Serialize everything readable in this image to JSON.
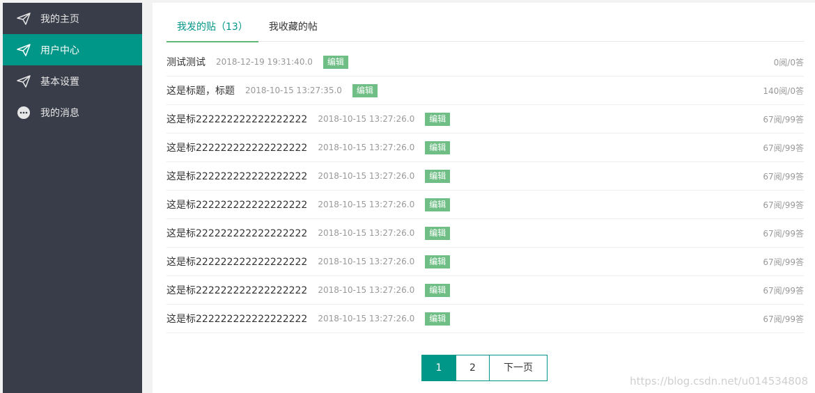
{
  "sidebar": {
    "items": [
      {
        "label": "我的主页",
        "icon": "paper-plane-icon",
        "active": false
      },
      {
        "label": "用户中心",
        "icon": "paper-plane-icon",
        "active": true
      },
      {
        "label": "基本设置",
        "icon": "paper-plane-icon",
        "active": false
      },
      {
        "label": "我的消息",
        "icon": "chat-bubble-icon",
        "active": false
      }
    ]
  },
  "tabs": [
    {
      "label": "我发的贴（13）",
      "active": true
    },
    {
      "label": "我收藏的帖",
      "active": false
    }
  ],
  "posts": [
    {
      "title": "测试测试",
      "time": "2018-12-19 19:31:40.0",
      "edit": "编辑",
      "stats": "0阅/0答"
    },
    {
      "title": "这是标题，标题",
      "time": "2018-10-15 13:27:35.0",
      "edit": "编辑",
      "stats": "140阅/0答"
    },
    {
      "title": "这是标222222222222222222",
      "time": "2018-10-15 13:27:26.0",
      "edit": "编辑",
      "stats": "67阅/99答"
    },
    {
      "title": "这是标222222222222222222",
      "time": "2018-10-15 13:27:26.0",
      "edit": "编辑",
      "stats": "67阅/99答"
    },
    {
      "title": "这是标222222222222222222",
      "time": "2018-10-15 13:27:26.0",
      "edit": "编辑",
      "stats": "67阅/99答"
    },
    {
      "title": "这是标222222222222222222",
      "time": "2018-10-15 13:27:26.0",
      "edit": "编辑",
      "stats": "67阅/99答"
    },
    {
      "title": "这是标222222222222222222",
      "time": "2018-10-15 13:27:26.0",
      "edit": "编辑",
      "stats": "67阅/99答"
    },
    {
      "title": "这是标222222222222222222",
      "time": "2018-10-15 13:27:26.0",
      "edit": "编辑",
      "stats": "67阅/99答"
    },
    {
      "title": "这是标222222222222222222",
      "time": "2018-10-15 13:27:26.0",
      "edit": "编辑",
      "stats": "67阅/99答"
    },
    {
      "title": "这是标222222222222222222",
      "time": "2018-10-15 13:27:26.0",
      "edit": "编辑",
      "stats": "67阅/99答"
    }
  ],
  "pagination": {
    "pages": [
      {
        "label": "1",
        "current": true
      },
      {
        "label": "2",
        "current": false
      }
    ],
    "next_label": "下一页"
  },
  "watermark": "https://blog.csdn.net/u014534808",
  "colors": {
    "accent": "#009688",
    "sidebar_bg": "#393d49",
    "badge": "#5fb878"
  }
}
